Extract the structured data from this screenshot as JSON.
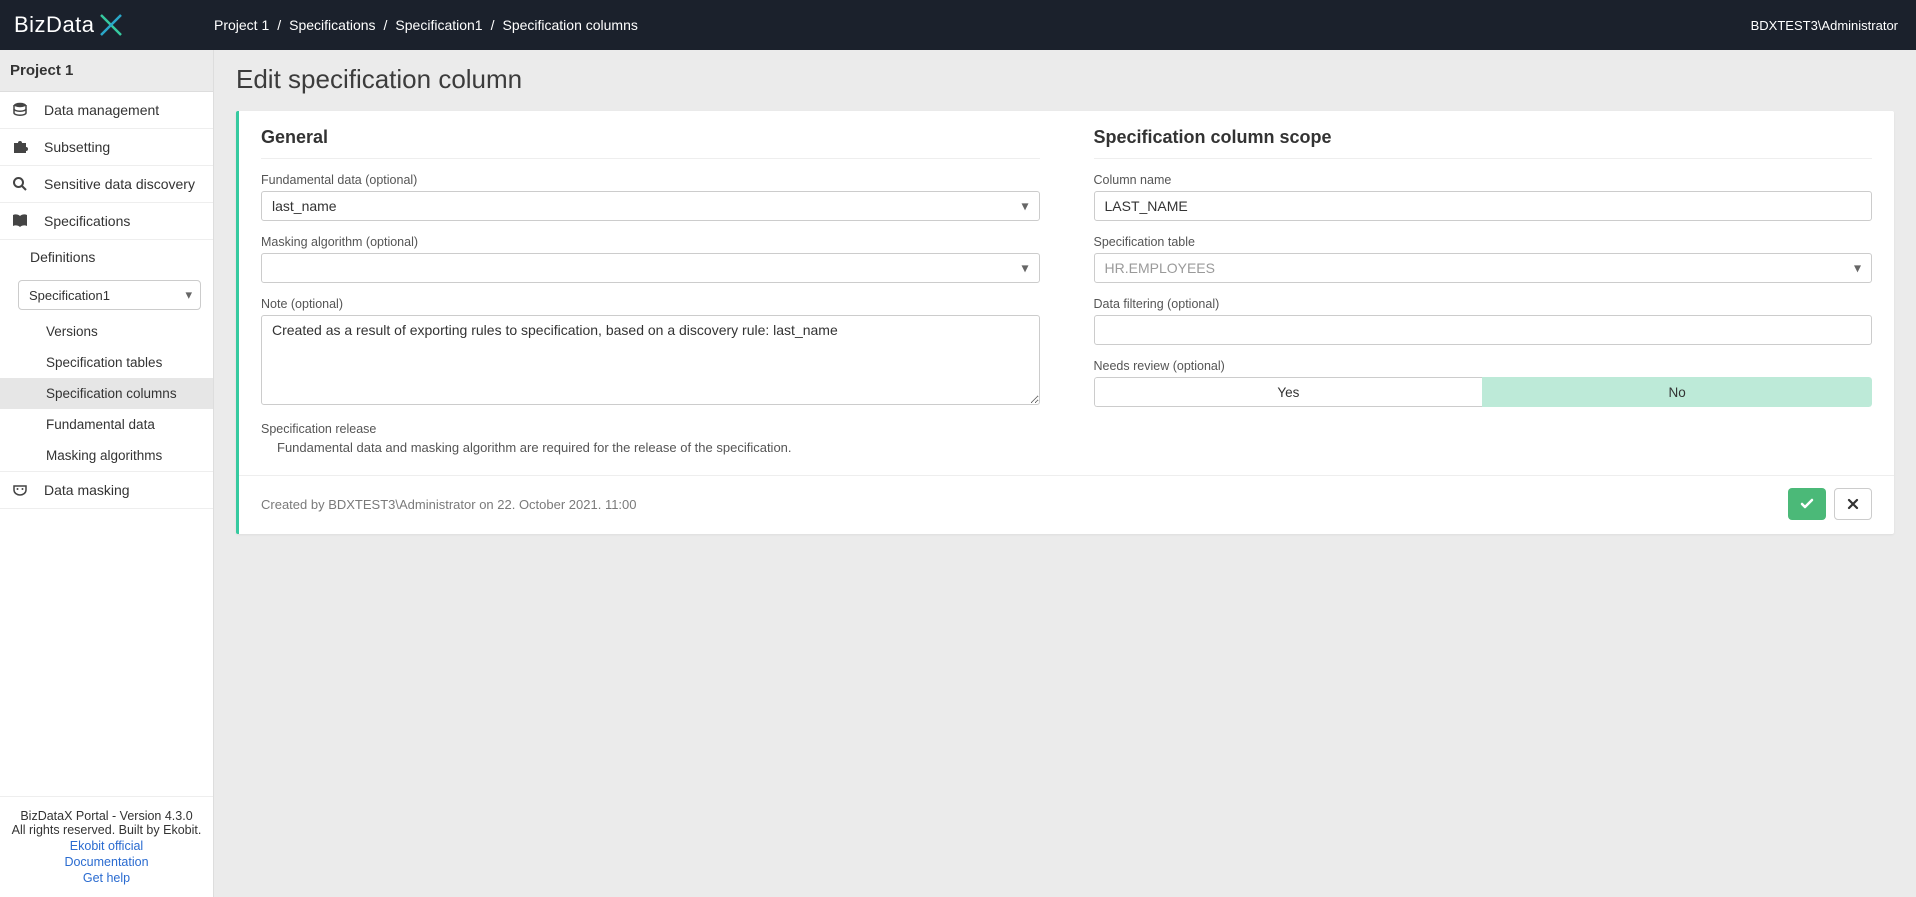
{
  "header": {
    "logo_text": "BizData",
    "breadcrumb": [
      "Project 1",
      "Specifications",
      "Specification1",
      "Specification columns"
    ],
    "user": "BDXTEST3\\Administrator"
  },
  "sidebar": {
    "project": "Project 1",
    "items": [
      {
        "label": "Data management"
      },
      {
        "label": "Subsetting"
      },
      {
        "label": "Sensitive data discovery"
      },
      {
        "label": "Specifications"
      }
    ],
    "definitions_label": "Definitions",
    "spec_selected": "Specification1",
    "leaves": [
      {
        "label": "Versions"
      },
      {
        "label": "Specification tables"
      },
      {
        "label": "Specification columns"
      },
      {
        "label": "Fundamental data"
      },
      {
        "label": "Masking algorithms"
      }
    ],
    "masking_label": "Data masking",
    "footer": {
      "line1": "BizDataX Portal - Version 4.3.0",
      "line2": "All rights reserved. Built by Ekobit.",
      "link1": "Ekobit official",
      "link2": "Documentation",
      "link3": "Get help"
    }
  },
  "page": {
    "title": "Edit specification column",
    "general": {
      "title": "General",
      "fundamental_label": "Fundamental data (optional)",
      "fundamental_value": "last_name",
      "masking_label": "Masking algorithm (optional)",
      "masking_value": "",
      "note_label": "Note (optional)",
      "note_value": "Created as a result of exporting rules to specification, based on a discovery rule: last_name",
      "release_label": "Specification release",
      "release_note": "Fundamental data and masking algorithm are required for the release of the specification."
    },
    "scope": {
      "title": "Specification column scope",
      "column_label": "Column name",
      "column_value": "LAST_NAME",
      "table_label": "Specification table",
      "table_value": "HR.EMPLOYEES",
      "filter_label": "Data filtering (optional)",
      "filter_value": "",
      "review_label": "Needs review (optional)",
      "review_yes": "Yes",
      "review_no": "No",
      "review_selected": "No"
    },
    "footer": {
      "created": "Created by BDXTEST3\\Administrator on 22. October 2021. 11:00"
    }
  }
}
